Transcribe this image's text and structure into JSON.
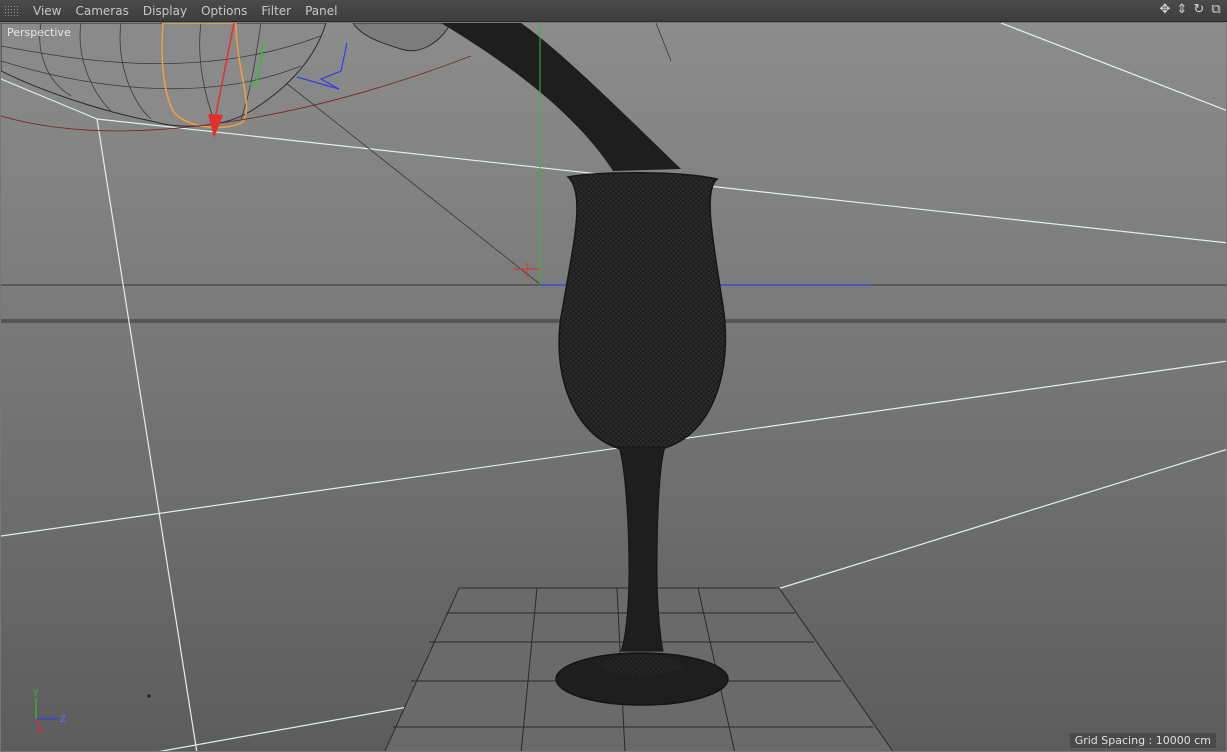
{
  "menu": {
    "items": [
      {
        "label": "View"
      },
      {
        "label": "Cameras"
      },
      {
        "label": "Display"
      },
      {
        "label": "Options"
      },
      {
        "label": "Filter"
      },
      {
        "label": "Panel"
      }
    ]
  },
  "nav_icons": [
    {
      "name": "move-view-icon",
      "glyph": "✥"
    },
    {
      "name": "dolly-view-icon",
      "glyph": "⇕"
    },
    {
      "name": "rotate-view-icon",
      "glyph": "↻"
    },
    {
      "name": "toggle-view-icon",
      "glyph": "⧉"
    }
  ],
  "viewport": {
    "camera_label": "Perspective",
    "grid_spacing_label": "Grid Spacing : 10000 cm"
  },
  "axis_gizmo": {
    "y_label": "Y",
    "z_label": "Z",
    "x_label": "X"
  },
  "colors": {
    "x_axis": "#e03030",
    "y_axis": "#30c030",
    "z_axis": "#3040e0",
    "selection": "#f0a040",
    "background": "#6e6e6e"
  }
}
